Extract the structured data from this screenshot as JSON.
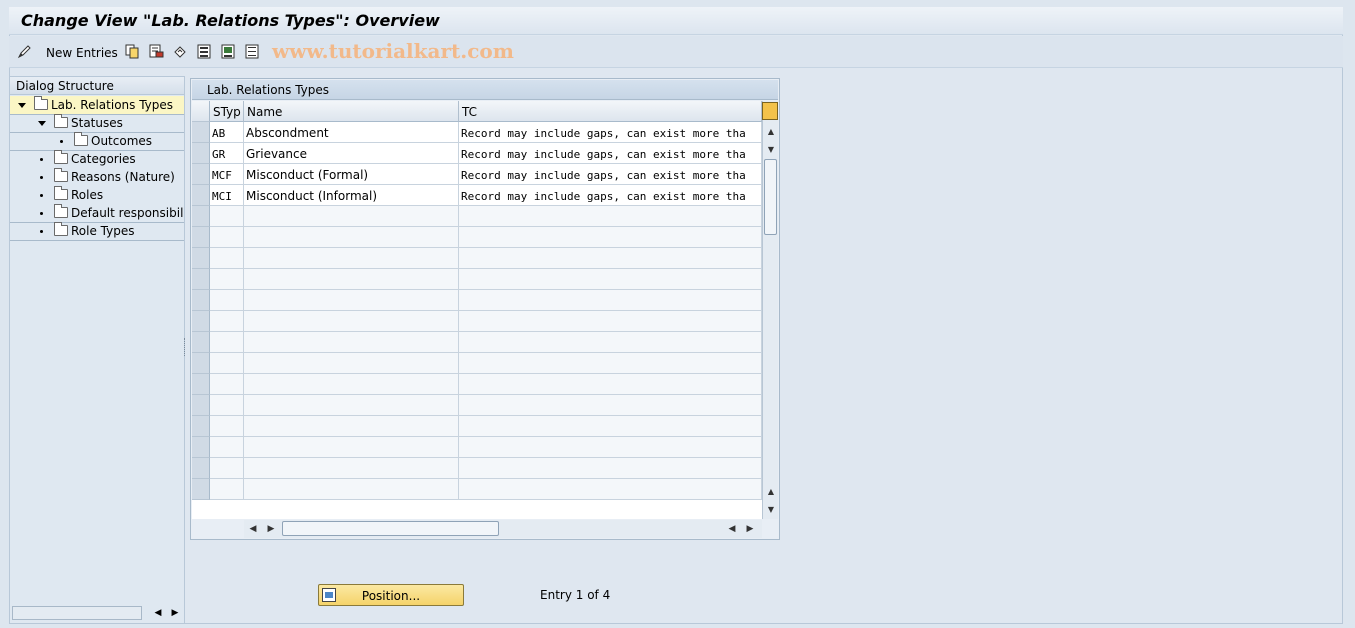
{
  "window": {
    "title": "Change View \"Lab. Relations Types\": Overview"
  },
  "toolbar": {
    "new_entries_label": "New Entries",
    "watermark": "www.tutorialkart.com",
    "icons": [
      "edit-pencil-icon",
      "copy-icon",
      "delete-icon",
      "undo-icon",
      "select-all-icon",
      "select-block-icon",
      "deselect-all-icon"
    ]
  },
  "dialog_structure": {
    "header": "Dialog Structure",
    "items": [
      {
        "label": "Lab. Relations Types",
        "selected": true
      },
      {
        "label": "Statuses"
      },
      {
        "label": "Outcomes"
      },
      {
        "label": "Categories"
      },
      {
        "label": "Reasons (Nature)"
      },
      {
        "label": "Roles"
      },
      {
        "label": "Default responsibilitie"
      },
      {
        "label": "Role Types"
      }
    ]
  },
  "table": {
    "title": "Lab. Relations Types",
    "columns": [
      "STyp",
      "Name",
      "TC"
    ],
    "rows": [
      {
        "styp": "AB",
        "name": "Abscondment",
        "tc": "Record may include gaps, can exist more tha"
      },
      {
        "styp": "GR",
        "name": "Grievance",
        "tc": "Record may include gaps, can exist more tha"
      },
      {
        "styp": "MCF",
        "name": "Misconduct (Formal)",
        "tc": "Record may include gaps, can exist more tha"
      },
      {
        "styp": "MCI",
        "name": "Misconduct (Informal)",
        "tc": "Record may include gaps, can exist more tha"
      }
    ]
  },
  "footer": {
    "position_label": "Position...",
    "entry_text": "Entry 1 of 4"
  },
  "colors": {
    "selected_row": "#fbf6c5",
    "position_button": "#f5d36a",
    "watermark": "#f2b98a"
  }
}
